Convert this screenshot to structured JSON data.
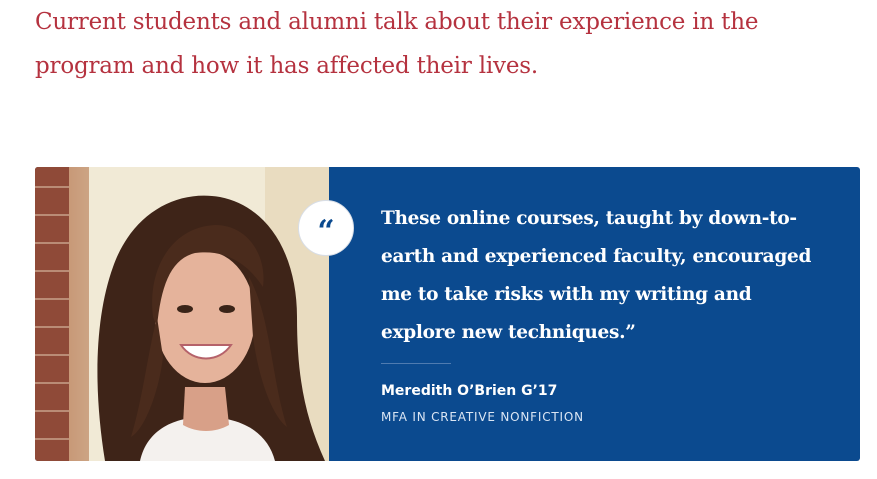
{
  "intro": {
    "text": "Current students and alumni talk about their experience in the program and how it has affected their lives."
  },
  "testimonial": {
    "quote_glyph": "“",
    "quote": "These online courses, taught by down-to-earth and experienced faculty, encouraged me to take risks with my writing and explore new techniques.”",
    "author": "Meredith O’Brien G’17",
    "program": "MFA IN CREATIVE NONFICTION"
  },
  "colors": {
    "accent_red": "#b5323f",
    "card_blue": "#0b4a8f"
  },
  "icons": {
    "quote": "quote-mark-icon"
  }
}
